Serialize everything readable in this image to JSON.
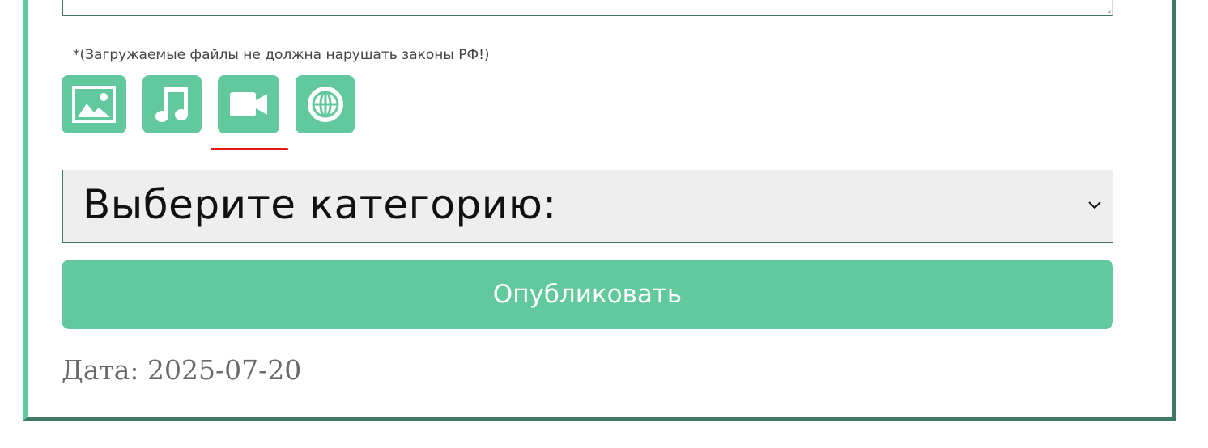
{
  "form": {
    "file_note": "*(Загружаемые файлы не должна нарушать законы РФ!)",
    "media_buttons": [
      {
        "icon": "image-icon",
        "active": false
      },
      {
        "icon": "music-note-icon",
        "active": false
      },
      {
        "icon": "video-camera-icon",
        "active": true
      },
      {
        "icon": "globe-icon",
        "active": false
      }
    ],
    "category_select": {
      "selected": "Выберите категорию:"
    },
    "publish_label": "Опубликовать",
    "date_text": "Дата: 2025-07-20"
  },
  "colors": {
    "accent": "#62c89e",
    "border_dark": "#3f7a66",
    "active_underline": "#e01818",
    "select_bg": "#eeeeee"
  }
}
